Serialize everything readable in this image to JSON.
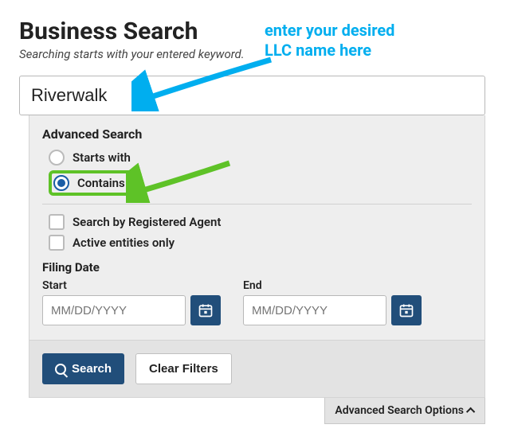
{
  "header": {
    "title": "Business Search",
    "subtitle": "Searching starts with your entered keyword."
  },
  "annotation": {
    "line1": "enter your desired",
    "line2": "LLC name here"
  },
  "search": {
    "value": "Riverwalk"
  },
  "advanced": {
    "title": "Advanced Search",
    "radio_startswith": "Starts with",
    "radio_contains": "Contains",
    "cb_agent": "Search by Registered Agent",
    "cb_active": "Active entities only",
    "filing_title": "Filing Date",
    "start_label": "Start",
    "end_label": "End",
    "date_placeholder": "MM/DD/YYYY"
  },
  "buttons": {
    "search": "Search",
    "clear": "Clear Filters",
    "options_tab": "Advanced Search Options"
  }
}
